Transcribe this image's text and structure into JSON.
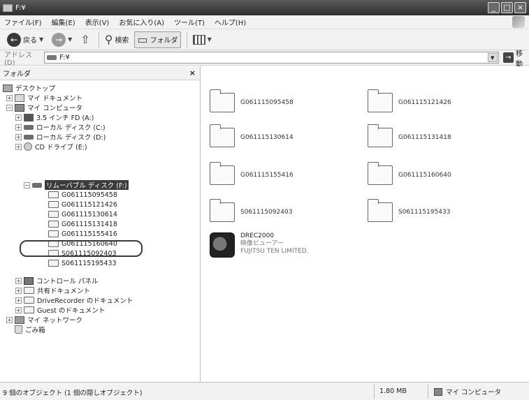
{
  "window": {
    "title": "F:¥"
  },
  "menu": [
    "ファイル(F)",
    "編集(E)",
    "表示(V)",
    "お気に入り(A)",
    "ツール(T)",
    "ヘルプ(H)"
  ],
  "toolbar": {
    "back_label": "戻る",
    "search_label": "検索",
    "folders_label": "フォルダ"
  },
  "address": {
    "label": "アドレス(D)",
    "value": "F:¥",
    "go_label": "移動"
  },
  "folder_pane": {
    "title": "フォルダ",
    "close_symbol": "×",
    "tree": [
      {
        "label": "デスクトップ",
        "icon": "desktop-icon"
      },
      {
        "label": "マイ ドキュメント",
        "icon": "documents-icon",
        "expander": "+"
      },
      {
        "label": "マイ コンピュータ",
        "icon": "computer-icon",
        "expander": "−"
      },
      {
        "label": "3.5 インチ FD (A:)",
        "icon": "floppy-icon",
        "expander": "+"
      },
      {
        "label": "ローカル ディスク (C:)",
        "icon": "hard-disk-icon",
        "expander": "+"
      },
      {
        "label": "ローカル ディスク (D:)",
        "icon": "hard-disk-icon",
        "expander": "+"
      },
      {
        "label": "CD ドライブ (E:)",
        "icon": "cd-drive-icon",
        "expander": "+"
      },
      {
        "label": "リムーバブル ディスク (F:)",
        "icon": "removable-disk-icon",
        "expander": "−",
        "selected": true
      },
      {
        "label": "G061115095458",
        "icon": "folder-icon"
      },
      {
        "label": "G061115121426",
        "icon": "folder-icon"
      },
      {
        "label": "G061115130614",
        "icon": "folder-icon"
      },
      {
        "label": "G061115131418",
        "icon": "folder-icon"
      },
      {
        "label": "G061115155416",
        "icon": "folder-icon"
      },
      {
        "label": "G061115160640",
        "icon": "folder-icon"
      },
      {
        "label": "S061115092403",
        "icon": "folder-icon"
      },
      {
        "label": "S061115195433",
        "icon": "folder-icon"
      },
      {
        "label": "コントロール パネル",
        "icon": "control-panel-icon",
        "expander": "+"
      },
      {
        "label": "共有ドキュメント",
        "icon": "folder-icon",
        "expander": "+"
      },
      {
        "label": "DriveRecorder のドキュメント",
        "icon": "folder-icon",
        "expander": "+"
      },
      {
        "label": "Guest のドキュメント",
        "icon": "folder-icon",
        "expander": "+"
      },
      {
        "label": "マイ ネットワーク",
        "icon": "network-icon",
        "expander": "+"
      },
      {
        "label": "ごみ箱",
        "icon": "recycle-bin-icon"
      }
    ]
  },
  "content": {
    "folders": [
      "G061115095458",
      "G061115121426",
      "G061115130614",
      "G061115131418",
      "G061115155416",
      "G061115160640",
      "S061115092403",
      "S061115195433"
    ],
    "app": {
      "name": "DREC2000",
      "description": "映像ビューアー",
      "company": "FUJITSU TEN LIMITED."
    }
  },
  "status": {
    "objects": "9 個のオブジェクト (1 個の隠しオブジェクト)",
    "size": "1.80 MB",
    "location": "マイ コンピュータ"
  }
}
